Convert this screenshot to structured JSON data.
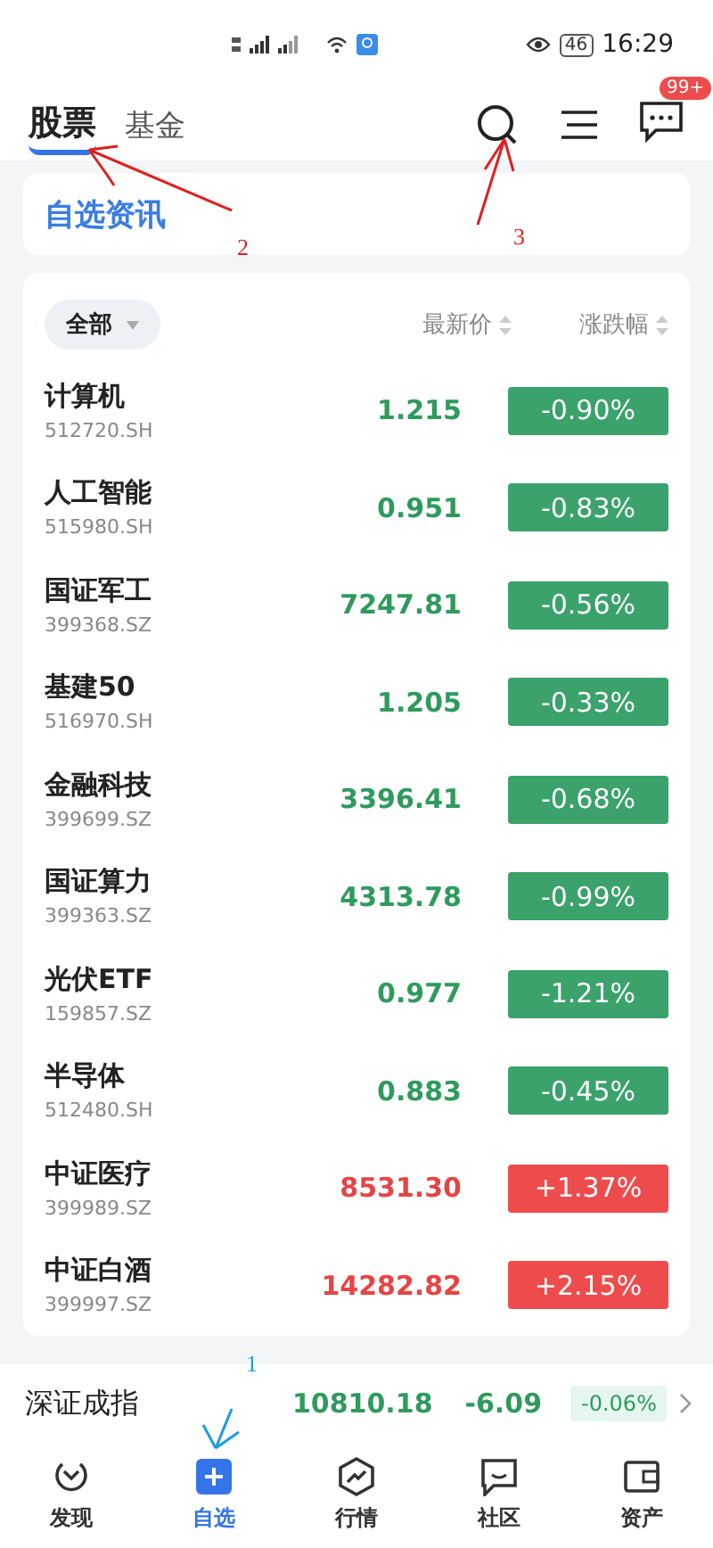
{
  "status_bar": {
    "battery": "46",
    "time": "16:29"
  },
  "tabs": [
    {
      "label": "股票",
      "selected": true
    },
    {
      "label": "基金",
      "selected": false
    }
  ],
  "message_badge": "99+",
  "news_card": {
    "title": "自选资讯"
  },
  "filter": {
    "label": "全部"
  },
  "columns": [
    "最新价",
    "涨跌幅"
  ],
  "rows": [
    {
      "name": "计算机",
      "code": "512720.SH",
      "price": "1.215",
      "change": "-0.90%",
      "kind": "down"
    },
    {
      "name": "人工智能",
      "code": "515980.SH",
      "price": "0.951",
      "change": "-0.83%",
      "kind": "down"
    },
    {
      "name": "国证军工",
      "code": "399368.SZ",
      "price": "7247.81",
      "change": "-0.56%",
      "kind": "down"
    },
    {
      "name": "基建50",
      "code": "516970.SH",
      "price": "1.205",
      "change": "-0.33%",
      "kind": "down"
    },
    {
      "name": "金融科技",
      "code": "399699.SZ",
      "price": "3396.41",
      "change": "-0.68%",
      "kind": "down"
    },
    {
      "name": "国证算力",
      "code": "399363.SZ",
      "price": "4313.78",
      "change": "-0.99%",
      "kind": "down"
    },
    {
      "name": "光伏ETF",
      "code": "159857.SZ",
      "price": "0.977",
      "change": "-1.21%",
      "kind": "down"
    },
    {
      "name": "半导体",
      "code": "512480.SH",
      "price": "0.883",
      "change": "-0.45%",
      "kind": "down"
    },
    {
      "name": "中证医疗",
      "code": "399989.SZ",
      "price": "8531.30",
      "change": "+1.37%",
      "kind": "up"
    },
    {
      "name": "中证白酒",
      "code": "399997.SZ",
      "price": "14282.82",
      "change": "+2.15%",
      "kind": "up"
    }
  ],
  "index_bar": {
    "name": "深证成指",
    "value": "10810.18",
    "change": "-6.09",
    "percent": "-0.06%",
    "kind": "down"
  },
  "nav": [
    {
      "label": "发现",
      "selected": false
    },
    {
      "label": "自选",
      "selected": true
    },
    {
      "label": "行情",
      "selected": false
    },
    {
      "label": "社区",
      "selected": false
    },
    {
      "label": "资产",
      "selected": false
    }
  ],
  "annotations": [
    {
      "label": "2",
      "color": "#e02020"
    },
    {
      "label": "3",
      "color": "#e02020"
    },
    {
      "label": "1",
      "color": "#1e9be0"
    }
  ]
}
